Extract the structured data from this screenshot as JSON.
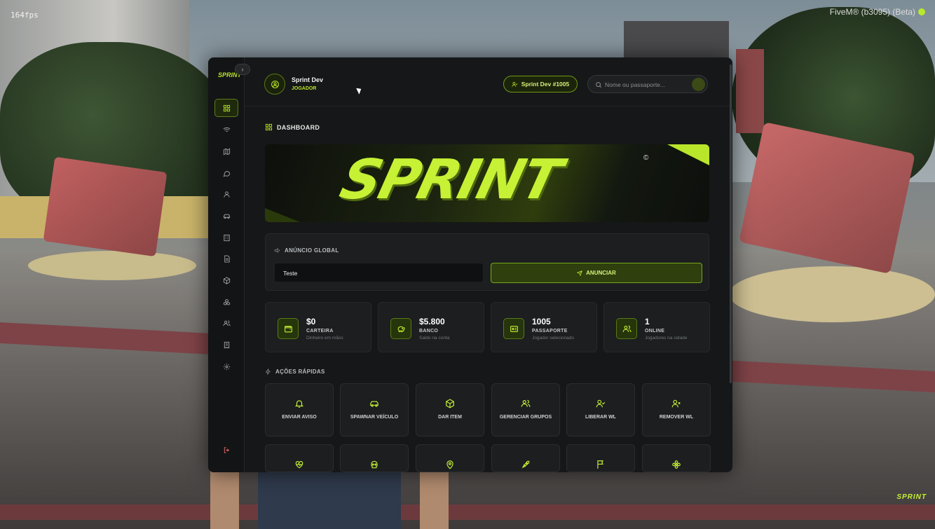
{
  "overlay": {
    "fps": "164fps",
    "fivem": "FiveM® (b3095) (Beta)",
    "watermark": "SPRINT"
  },
  "user": {
    "name": "Sprint Dev",
    "role": "JOGADOR",
    "id_pill": "Sprint Dev #1005"
  },
  "search": {
    "placeholder": "Nome ou passaporte..."
  },
  "sidebar": {
    "logo": "SPRINT",
    "collapse": "›",
    "items": [
      {
        "icon": "grid-icon",
        "active": true
      },
      {
        "icon": "wifi-icon"
      },
      {
        "icon": "map-icon"
      },
      {
        "icon": "chat-icon"
      },
      {
        "icon": "user-icon"
      },
      {
        "icon": "car-icon"
      },
      {
        "icon": "building-icon"
      },
      {
        "icon": "document-icon"
      },
      {
        "icon": "box-icon"
      },
      {
        "icon": "cubes-icon"
      },
      {
        "icon": "users-icon"
      },
      {
        "icon": "receipt-icon"
      },
      {
        "icon": "gear-icon"
      }
    ],
    "logout_icon": "logout-icon"
  },
  "dashboard": {
    "title": "DASHBOARD",
    "banner": {
      "brand": "SPRINT",
      "mark": "©"
    }
  },
  "announce": {
    "title": "ANÚNCIO GLOBAL",
    "value": "Teste",
    "button": "ANUNCIAR"
  },
  "stats": [
    {
      "icon": "wallet-icon",
      "value": "$0",
      "label": "CARTEIRA",
      "sub": "Dinheiro em mãos"
    },
    {
      "icon": "piggy-bank-icon",
      "value": "$5.800",
      "label": "BANCO",
      "sub": "Saldo na conta"
    },
    {
      "icon": "id-card-icon",
      "value": "1005",
      "label": "PASSAPORTE",
      "sub": "Jogador selecionado"
    },
    {
      "icon": "users-icon",
      "value": "1",
      "label": "ONLINE",
      "sub": "Jogadores na cidade"
    }
  ],
  "quick": {
    "title": "AÇÕES RÁPIDAS",
    "row1": [
      {
        "icon": "bell-icon",
        "label": "ENVIAR AVISO"
      },
      {
        "icon": "car-icon",
        "label": "SPAWNAR VEÍCULO"
      },
      {
        "icon": "box-icon",
        "label": "DAR ITEM"
      },
      {
        "icon": "users-icon",
        "label": "GERENCIAR GRUPOS"
      },
      {
        "icon": "user-check-icon",
        "label": "LIBERAR WL"
      },
      {
        "icon": "user-x-icon",
        "label": "REMOVER WL"
      }
    ],
    "row2": [
      {
        "icon": "heart-pulse-icon"
      },
      {
        "icon": "skull-icon"
      },
      {
        "icon": "map-pin-icon"
      },
      {
        "icon": "rocket-icon"
      },
      {
        "icon": "flag-icon"
      },
      {
        "icon": "flower-icon"
      }
    ]
  },
  "colors": {
    "accent": "#b9e52a",
    "panel": "#161718",
    "card": "#1c1e20"
  }
}
